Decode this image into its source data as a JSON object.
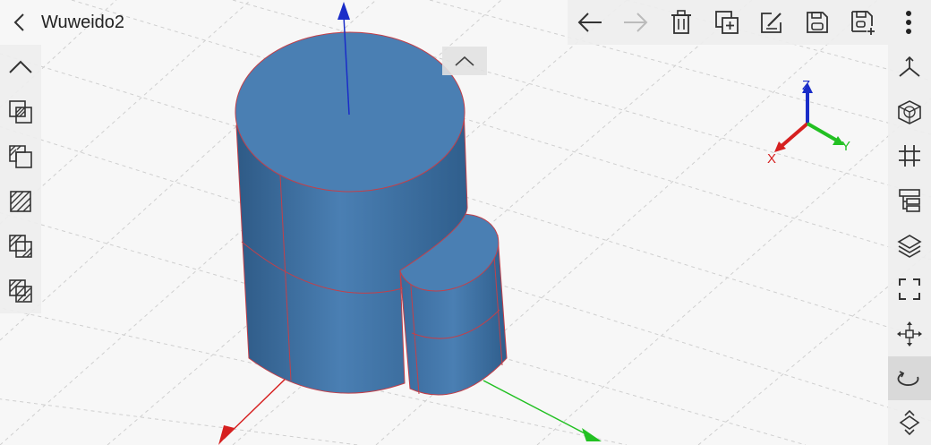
{
  "header": {
    "title": "Wuweido2"
  },
  "toolbar": {
    "items": [
      {
        "icon": "undo-arrow-icon",
        "enabled": true
      },
      {
        "icon": "redo-arrow-icon",
        "enabled": false
      },
      {
        "icon": "trash-icon"
      },
      {
        "icon": "duplicate-icon"
      },
      {
        "icon": "edit-icon"
      },
      {
        "icon": "save-icon"
      },
      {
        "icon": "save-as-icon"
      },
      {
        "icon": "more-vertical-icon"
      }
    ]
  },
  "left_panel": {
    "items": [
      "collapse-up-icon",
      "boolean-intersect-icon",
      "boolean-subtract-icon",
      "hatch-fill-icon",
      "boolean-union-icon",
      "hatch-combine-icon"
    ]
  },
  "right_panel": {
    "items": [
      "axis-view-icon",
      "cube-view-icon",
      "grid-icon",
      "layer-tree-icon",
      "layers-icon",
      "fit-screen-icon",
      "move-icon",
      "rotate-icon",
      "explode-icon"
    ],
    "active": "rotate-icon"
  },
  "gizmo": {
    "x": "X",
    "y": "Y",
    "z": "Z"
  },
  "colors": {
    "solid": "#4a7fb3",
    "edge": "#c2404a",
    "x_axis": "#d62020",
    "y_axis": "#22c022",
    "z_axis": "#1a2dc8",
    "grid": "#c9c9c9"
  }
}
